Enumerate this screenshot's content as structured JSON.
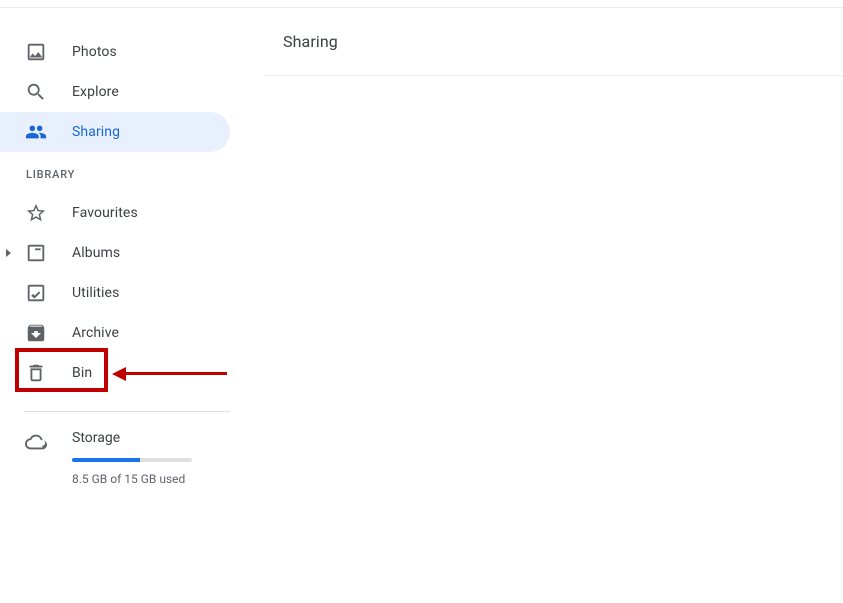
{
  "sidebar": {
    "nav": [
      {
        "label": "Photos"
      },
      {
        "label": "Explore"
      },
      {
        "label": "Sharing"
      }
    ],
    "library_header": "LIBRARY",
    "library": [
      {
        "label": "Favourites"
      },
      {
        "label": "Albums"
      },
      {
        "label": "Utilities"
      },
      {
        "label": "Archive"
      },
      {
        "label": "Bin"
      }
    ],
    "storage": {
      "label": "Storage",
      "used_text": "8.5 GB of 15 GB used",
      "fill_pct": "56.7%"
    }
  },
  "main": {
    "title": "Sharing"
  }
}
